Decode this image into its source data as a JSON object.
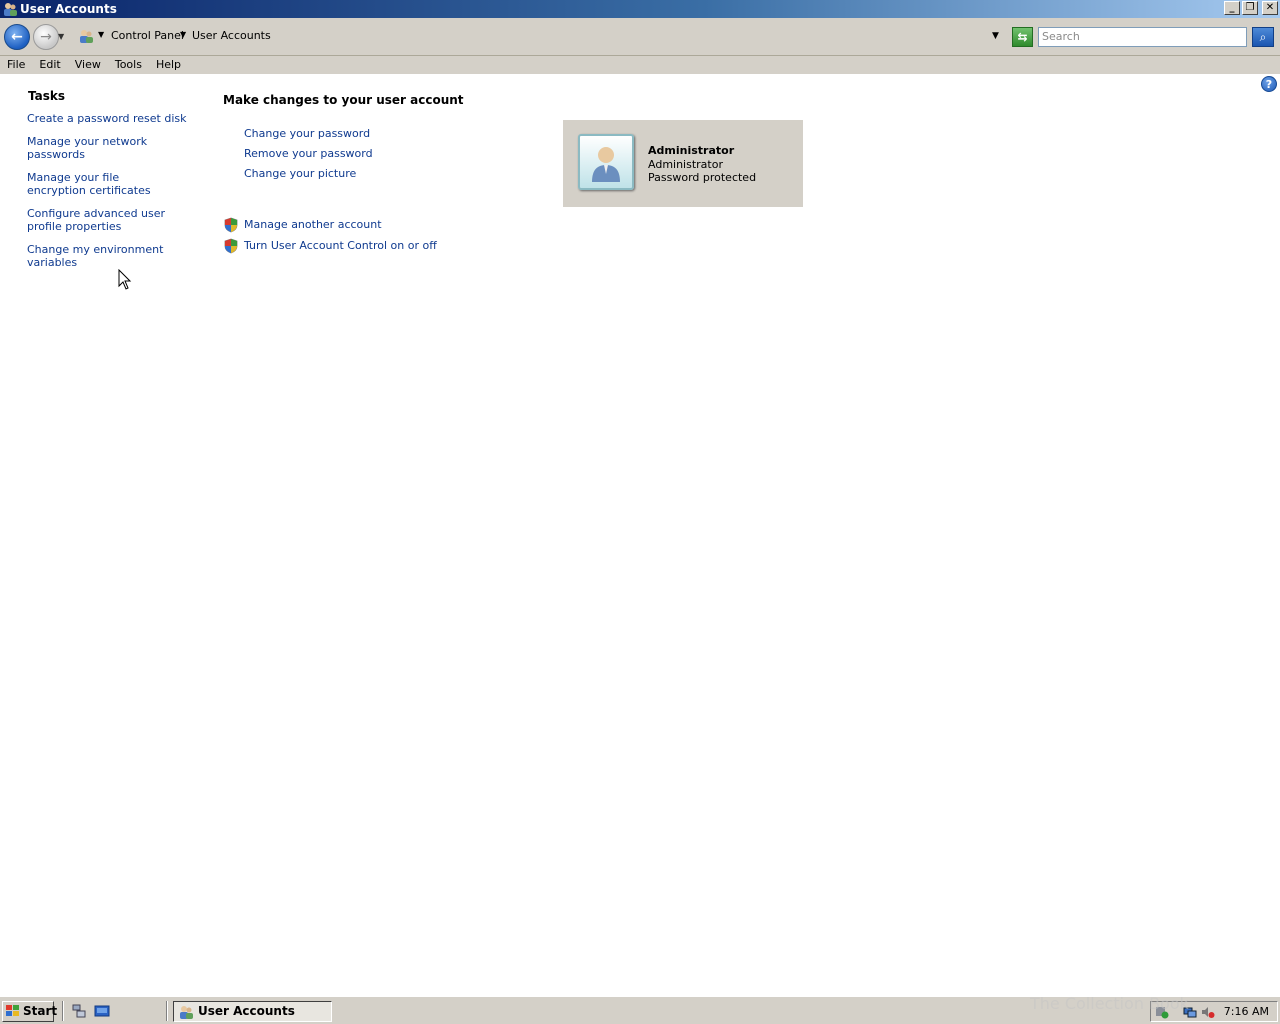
{
  "window": {
    "title": "User Accounts"
  },
  "address": {
    "crumbs": [
      "Control Panel",
      "User Accounts"
    ],
    "search_placeholder": "Search"
  },
  "menu": [
    "File",
    "Edit",
    "View",
    "Tools",
    "Help"
  ],
  "tasks": {
    "title": "Tasks",
    "links": [
      "Create a password reset disk",
      "Manage your network passwords",
      "Manage your file encryption certificates",
      "Configure advanced user profile properties",
      "Change my environment variables"
    ]
  },
  "main": {
    "title": "Make changes to your user account",
    "links": [
      "Change your password",
      "Remove your password",
      "Change your picture"
    ],
    "shield_links": [
      "Manage another account",
      "Turn User Account Control on or off"
    ]
  },
  "account": {
    "name": "Administrator",
    "role": "Administrator",
    "status": "Password protected"
  },
  "taskbar": {
    "start_label": "Start",
    "active_task": "User Accounts",
    "clock": "7:16 AM",
    "watermark": "The Collection Book"
  }
}
